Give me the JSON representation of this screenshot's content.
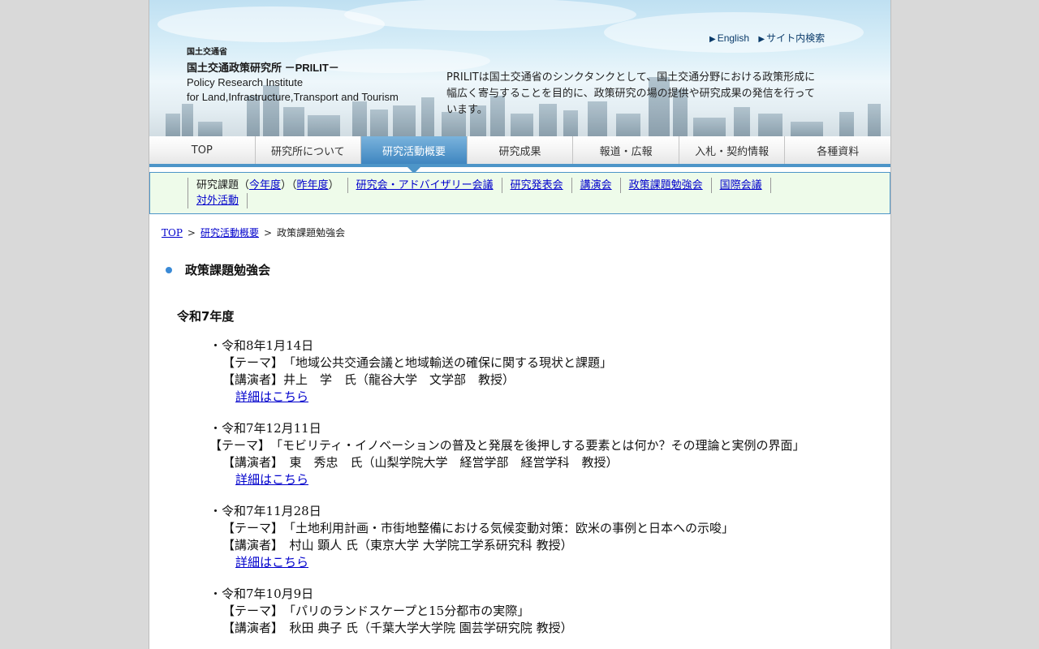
{
  "header": {
    "ministry": "国土交通省",
    "institute_name": "国土交通政策研究所 －PRILIT－",
    "english_name_line1": "Policy Research Institute",
    "english_name_line2": "for Land,Infrastructure,Transport and Tourism",
    "tagline": "PRILITは国土交通省のシンクタンクとして、国土交通分野における政策形成に幅広く寄与することを目的に、政策研究の場の提供や研究成果の発信を行っています。",
    "links": {
      "english": "English",
      "site_search": "サイト内検索"
    }
  },
  "gnav": {
    "items": [
      {
        "label": "TOP"
      },
      {
        "label": "研究所について"
      },
      {
        "label": "研究活動概要"
      },
      {
        "label": "研究成果"
      },
      {
        "label": "報道・広報"
      },
      {
        "label": "入札・契約情報"
      },
      {
        "label": "各種資料"
      }
    ],
    "active_index": 2
  },
  "subnav": {
    "research_topics_prefix": "研究課題（",
    "this_year": "今年度",
    "mid": "）（",
    "last_year": "昨年度",
    "suffix": "）",
    "links": [
      "研究会・アドバイザリー会議",
      "研究発表会",
      "講演会",
      "政策課題勉強会",
      "国際会議",
      "対外活動"
    ]
  },
  "breadcrumb": {
    "top": "TOP",
    "sep": ">",
    "section": "研究活動概要",
    "current": "政策課題勉強会"
  },
  "main": {
    "title": "政策課題勉強会",
    "year_heading": "令和7年度",
    "entries": [
      {
        "date": "・令和8年1月14日",
        "theme": "【テーマ】　「地域公共交通会議と地域輸送の確保に関する現状と課題」",
        "speaker": "【講演者】井上　学　氏（龍谷大学　文学部　教授）",
        "link": "詳細はこちら"
      },
      {
        "date": "・令和7年12月11日",
        "theme": "【テーマ】　「モビリティ・イノベーションの普及と発展を後押しする要素とは何か？その理論と実例の界面」",
        "speaker": "【講演者】　東　秀忠　氏（山梨学院大学　経営学部　経営学科　教授）",
        "link": "詳細はこちら"
      },
      {
        "date": "・令和7年11月28日",
        "theme": "【テーマ】　「土地利用計画・市街地整備における気候変動対策：欧米の事例と日本への示唆」",
        "speaker": "【講演者】　村山 顕人 氏（東京大学 大学院工学系研究科 教授）",
        "link": "詳細はこちら"
      },
      {
        "date": "・令和7年10月9日",
        "theme": "【テーマ】　「パリのランドスケープと15分都市の実際」",
        "speaker": "【講演者】　秋田 典子 氏（千葉大学大学院 園芸学研究院 教授）",
        "link": ""
      }
    ]
  }
}
